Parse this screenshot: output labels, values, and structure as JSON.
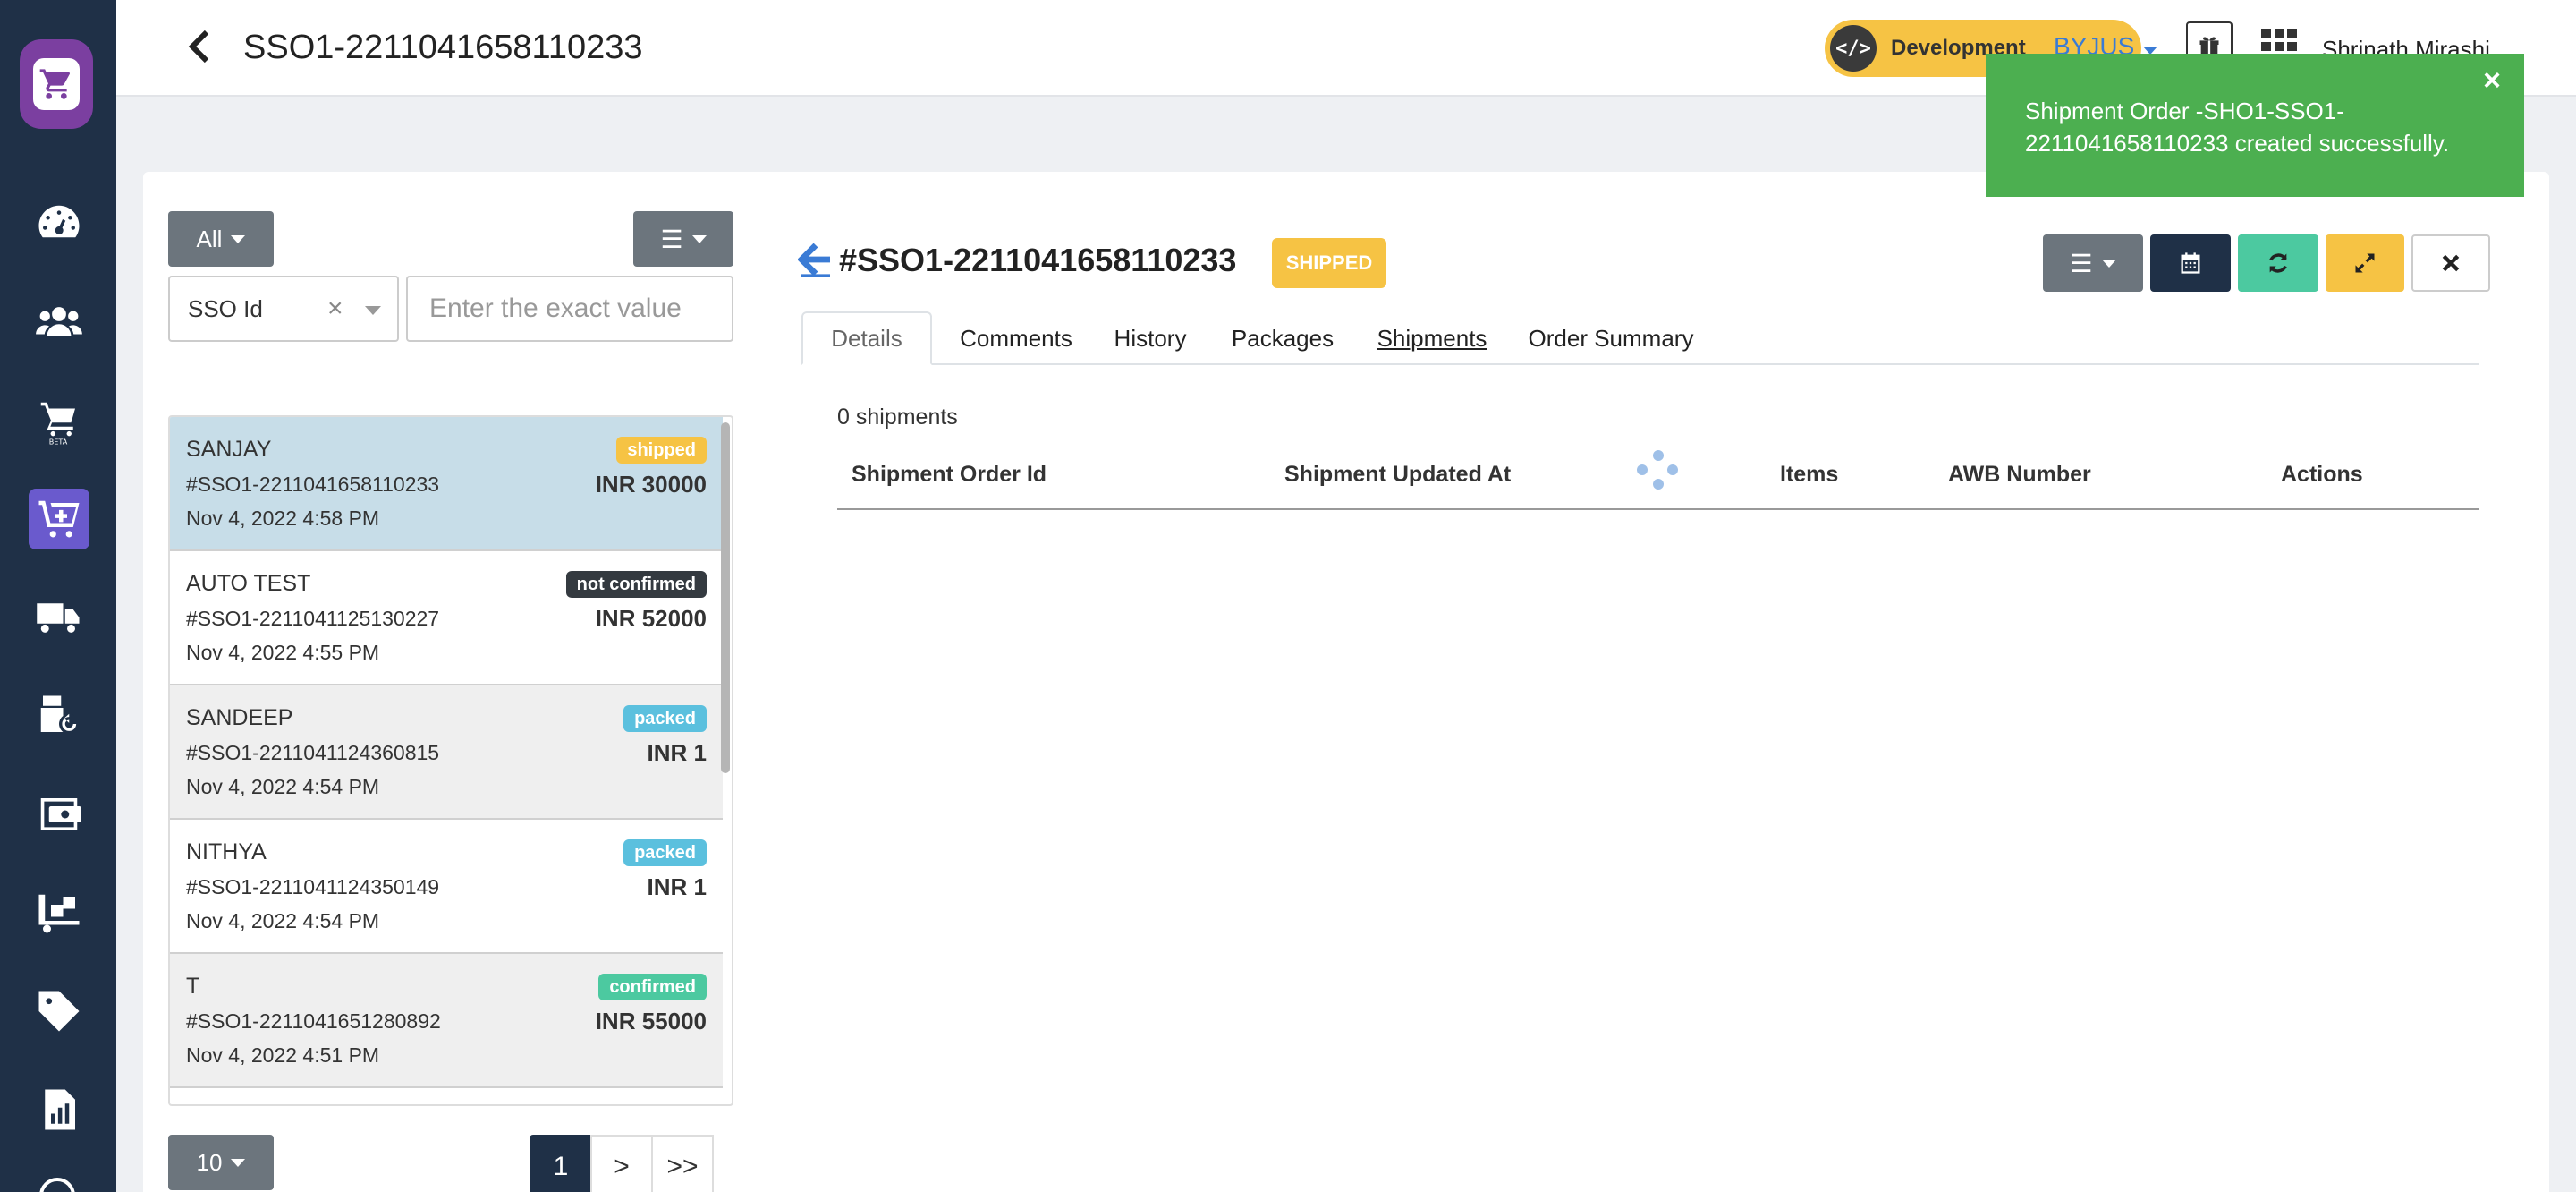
{
  "header": {
    "title": "SSO1-2211041658110233",
    "environment": "Development",
    "org": "BYJUS",
    "user": "Shrinath Mirashi"
  },
  "toast": {
    "message": "Shipment Order -SHO1-SSO1-2211041658110233 created successfully.",
    "close": "×"
  },
  "sidebar": {
    "icons": [
      "dashboard-icon",
      "users-icon",
      "beta-icon",
      "cart-icon",
      "truck-icon",
      "returns-icon",
      "billing-icon",
      "inventory-icon",
      "tag-icon",
      "reports-icon"
    ]
  },
  "left_panel": {
    "filter_all": "All",
    "filter_field": "SSO Id",
    "filter_clear": "×",
    "filter_placeholder": "Enter the exact value",
    "page_size": "10",
    "orders": [
      {
        "name": "SANJAY",
        "id": "#SSO1-2211041658110233",
        "date": "Nov 4, 2022 4:58 PM",
        "status": "shipped",
        "amount": "INR 30000"
      },
      {
        "name": "AUTO TEST",
        "id": "#SSO1-2211041125130227",
        "date": "Nov 4, 2022 4:55 PM",
        "status": "not confirmed",
        "amount": "INR 52000"
      },
      {
        "name": "SANDEEP",
        "id": "#SSO1-2211041124360815",
        "date": "Nov 4, 2022 4:54 PM",
        "status": "packed",
        "amount": "INR 1"
      },
      {
        "name": "NITHYA",
        "id": "#SSO1-2211041124350149",
        "date": "Nov 4, 2022 4:54 PM",
        "status": "packed",
        "amount": "INR 1"
      },
      {
        "name": "T",
        "id": "#SSO1-2211041651280892",
        "date": "Nov 4, 2022 4:51 PM",
        "status": "confirmed",
        "amount": "INR 55000"
      }
    ],
    "status_colors": {
      "shipped": "#f6c344",
      "not confirmed": "#343a40",
      "packed": "#5bc0de",
      "confirmed": "#4cc9a0"
    },
    "pagination": [
      "1",
      ">",
      ">>"
    ]
  },
  "detail": {
    "title": "#SSO1-2211041658110233",
    "status": "SHIPPED",
    "tabs": [
      "Details",
      "Comments",
      "History",
      "Packages",
      "Shipments",
      "Order Summary"
    ],
    "shipments_count": "0 shipments",
    "columns": [
      "Shipment Order Id",
      "Shipment Updated At",
      "Items",
      "AWB Number",
      "Actions"
    ]
  }
}
